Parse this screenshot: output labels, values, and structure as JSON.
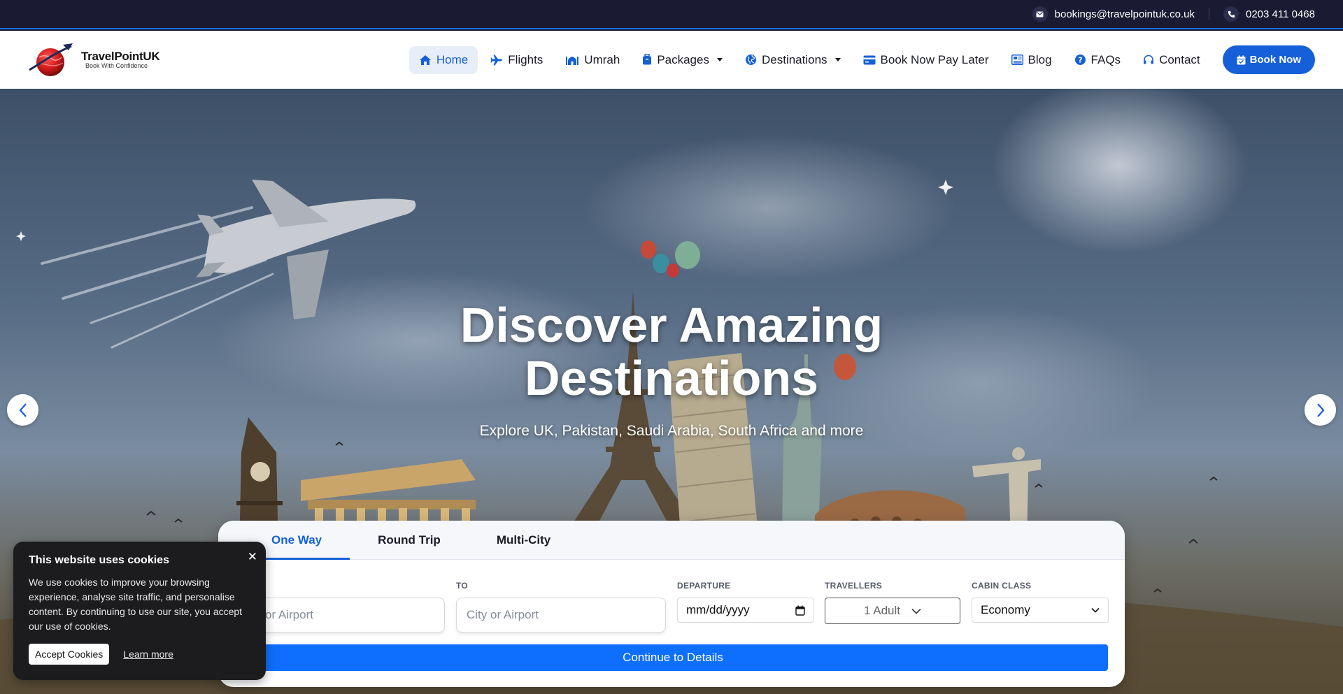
{
  "topbar": {
    "email": "bookings@travelpointuk.co.uk",
    "phone": "0203 411 0468"
  },
  "brand": {
    "name": "TravelPointUK",
    "tagline": "Book With Confidence"
  },
  "nav": {
    "items": [
      {
        "label": "Home",
        "icon": "home-icon",
        "active": true
      },
      {
        "label": "Flights",
        "icon": "plane-icon"
      },
      {
        "label": "Umrah",
        "icon": "mosque-icon"
      },
      {
        "label": "Packages",
        "icon": "luggage-icon",
        "dropdown": true
      },
      {
        "label": "Destinations",
        "icon": "globe-icon",
        "dropdown": true
      },
      {
        "label": "Book Now Pay Later",
        "icon": "credit-card-icon"
      },
      {
        "label": "Blog",
        "icon": "newspaper-icon"
      },
      {
        "label": "FAQs",
        "icon": "question-icon"
      },
      {
        "label": "Contact",
        "icon": "headset-icon"
      }
    ],
    "book_label": "Book Now"
  },
  "hero": {
    "title_line1": "Discover Amazing",
    "title_line2": "Destinations",
    "subtitle": "Explore UK, Pakistan, Saudi Arabia, South Africa and more"
  },
  "search": {
    "tabs": [
      {
        "label": "One Way",
        "active": true
      },
      {
        "label": "Round Trip"
      },
      {
        "label": "Multi-City"
      }
    ],
    "from_placeholder": "City or Airport",
    "to_label": "TO",
    "to_placeholder": "City or Airport",
    "departure_label": "DEPARTURE",
    "departure_placeholder": "mm/dd/yyyy",
    "travellers_label": "TRAVELLERS",
    "travellers_value": "1 Adult",
    "cabin_label": "CABIN CLASS",
    "cabin_value": "Economy",
    "continue_label": "Continue to Details"
  },
  "cookie": {
    "title": "This website uses cookies",
    "text": "We use cookies to improve your browsing experience, analyse site traffic, and personalise content. By continuing to use our site, you accept our use of cookies.",
    "accept_label": "Accept Cookies",
    "learn_label": "Learn more"
  },
  "colors": {
    "primary": "#1560d8",
    "button": "#0e6efd",
    "topbar": "#1a1a33"
  }
}
